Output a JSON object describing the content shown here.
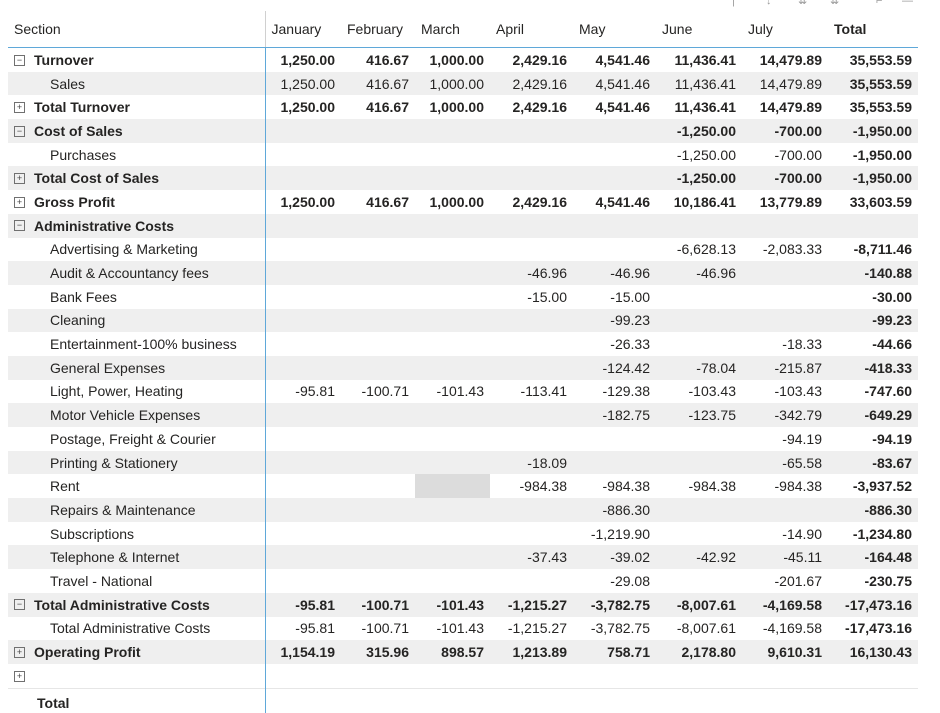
{
  "columns": [
    "Section",
    "January",
    "February",
    "March",
    "April",
    "May",
    "June",
    "July",
    "Total"
  ],
  "rows": [
    {
      "label": "Turnover",
      "expander": "⊟",
      "indent": false,
      "bold": true,
      "shade": false,
      "values": [
        "1,250.00",
        "416.67",
        "1,000.00",
        "2,429.16",
        "4,541.46",
        "11,436.41",
        "14,479.89",
        "35,553.59"
      ]
    },
    {
      "label": "Sales",
      "expander": "",
      "indent": true,
      "bold": false,
      "shade": true,
      "values": [
        "1,250.00",
        "416.67",
        "1,000.00",
        "2,429.16",
        "4,541.46",
        "11,436.41",
        "14,479.89",
        "35,553.59"
      ]
    },
    {
      "label": "Total Turnover",
      "expander": "⊞",
      "indent": false,
      "bold": true,
      "shade": false,
      "values": [
        "1,250.00",
        "416.67",
        "1,000.00",
        "2,429.16",
        "4,541.46",
        "11,436.41",
        "14,479.89",
        "35,553.59"
      ]
    },
    {
      "label": "Cost of Sales",
      "expander": "⊟",
      "indent": false,
      "bold": true,
      "shade": true,
      "values": [
        "",
        "",
        "",
        "",
        "",
        "-1,250.00",
        "-700.00",
        "-1,950.00"
      ]
    },
    {
      "label": "Purchases",
      "expander": "",
      "indent": true,
      "bold": false,
      "shade": false,
      "values": [
        "",
        "",
        "",
        "",
        "",
        "-1,250.00",
        "-700.00",
        "-1,950.00"
      ]
    },
    {
      "label": "Total Cost of Sales",
      "expander": "⊞",
      "indent": false,
      "bold": true,
      "shade": true,
      "values": [
        "",
        "",
        "",
        "",
        "",
        "-1,250.00",
        "-700.00",
        "-1,950.00"
      ]
    },
    {
      "label": "Gross Profit",
      "expander": "⊞",
      "indent": false,
      "bold": true,
      "shade": false,
      "values": [
        "1,250.00",
        "416.67",
        "1,000.00",
        "2,429.16",
        "4,541.46",
        "10,186.41",
        "13,779.89",
        "33,603.59"
      ]
    },
    {
      "label": "Administrative Costs",
      "expander": "⊟",
      "indent": false,
      "bold": true,
      "shade": true,
      "values": [
        "",
        "",
        "",
        "",
        "",
        "",
        "",
        ""
      ]
    },
    {
      "label": "Advertising & Marketing",
      "expander": "",
      "indent": true,
      "bold": false,
      "shade": false,
      "values": [
        "",
        "",
        "",
        "",
        "",
        "-6,628.13",
        "-2,083.33",
        "-8,711.46"
      ]
    },
    {
      "label": "Audit & Accountancy fees",
      "expander": "",
      "indent": true,
      "bold": false,
      "shade": true,
      "values": [
        "",
        "",
        "",
        "-46.96",
        "-46.96",
        "-46.96",
        "",
        "-140.88"
      ]
    },
    {
      "label": "Bank Fees",
      "expander": "",
      "indent": true,
      "bold": false,
      "shade": false,
      "values": [
        "",
        "",
        "",
        "-15.00",
        "-15.00",
        "",
        "",
        "-30.00"
      ]
    },
    {
      "label": "Cleaning",
      "expander": "",
      "indent": true,
      "bold": false,
      "shade": true,
      "values": [
        "",
        "",
        "",
        "",
        "-99.23",
        "",
        "",
        "-99.23"
      ]
    },
    {
      "label": "Entertainment-100% business",
      "expander": "",
      "indent": true,
      "bold": false,
      "shade": false,
      "values": [
        "",
        "",
        "",
        "",
        "-26.33",
        "",
        "-18.33",
        "-44.66"
      ]
    },
    {
      "label": "General Expenses",
      "expander": "",
      "indent": true,
      "bold": false,
      "shade": true,
      "values": [
        "",
        "",
        "",
        "",
        "-124.42",
        "-78.04",
        "-215.87",
        "-418.33"
      ]
    },
    {
      "label": "Light, Power, Heating",
      "expander": "",
      "indent": true,
      "bold": false,
      "shade": false,
      "values": [
        "-95.81",
        "-100.71",
        "-101.43",
        "-113.41",
        "-129.38",
        "-103.43",
        "-103.43",
        "-747.60"
      ]
    },
    {
      "label": "Motor Vehicle Expenses",
      "expander": "",
      "indent": true,
      "bold": false,
      "shade": true,
      "values": [
        "",
        "",
        "",
        "",
        "-182.75",
        "-123.75",
        "-342.79",
        "-649.29"
      ]
    },
    {
      "label": "Postage, Freight & Courier",
      "expander": "",
      "indent": true,
      "bold": false,
      "shade": false,
      "values": [
        "",
        "",
        "",
        "",
        "",
        "",
        "-94.19",
        "-94.19"
      ]
    },
    {
      "label": "Printing & Stationery",
      "expander": "",
      "indent": true,
      "bold": false,
      "shade": true,
      "values": [
        "",
        "",
        "",
        "-18.09",
        "",
        "",
        "-65.58",
        "-83.67"
      ]
    },
    {
      "label": "Rent",
      "expander": "",
      "indent": true,
      "bold": false,
      "shade": false,
      "selected_col": 2,
      "values": [
        "",
        "",
        "",
        "-984.38",
        "-984.38",
        "-984.38",
        "-984.38",
        "-3,937.52"
      ]
    },
    {
      "label": "Repairs & Maintenance",
      "expander": "",
      "indent": true,
      "bold": false,
      "shade": true,
      "values": [
        "",
        "",
        "",
        "",
        "-886.30",
        "",
        "",
        "-886.30"
      ]
    },
    {
      "label": "Subscriptions",
      "expander": "",
      "indent": true,
      "bold": false,
      "shade": false,
      "values": [
        "",
        "",
        "",
        "",
        "-1,219.90",
        "",
        "-14.90",
        "-1,234.80"
      ]
    },
    {
      "label": "Telephone & Internet",
      "expander": "",
      "indent": true,
      "bold": false,
      "shade": true,
      "values": [
        "",
        "",
        "",
        "-37.43",
        "-39.02",
        "-42.92",
        "-45.11",
        "-164.48"
      ]
    },
    {
      "label": "Travel - National",
      "expander": "",
      "indent": true,
      "bold": false,
      "shade": false,
      "values": [
        "",
        "",
        "",
        "",
        "-29.08",
        "",
        "-201.67",
        "-230.75"
      ]
    },
    {
      "label": "Total Administrative Costs",
      "expander": "⊟",
      "indent": false,
      "bold": true,
      "shade": true,
      "values": [
        "-95.81",
        "-100.71",
        "-101.43",
        "-1,215.27",
        "-3,782.75",
        "-8,007.61",
        "-4,169.58",
        "-17,473.16"
      ]
    },
    {
      "label": "Total Administrative Costs",
      "expander": "",
      "indent": true,
      "bold": false,
      "shade": false,
      "values": [
        "-95.81",
        "-100.71",
        "-101.43",
        "-1,215.27",
        "-3,782.75",
        "-8,007.61",
        "-4,169.58",
        "-17,473.16"
      ]
    },
    {
      "label": "Operating Profit",
      "expander": "⊞",
      "indent": false,
      "bold": true,
      "shade": true,
      "values": [
        "1,154.19",
        "315.96",
        "898.57",
        "1,213.89",
        "758.71",
        "2,178.80",
        "9,610.31",
        "16,130.43"
      ]
    },
    {
      "label": "",
      "expander": "⊞",
      "indent": false,
      "bold": false,
      "shade": false,
      "blank": true,
      "values": [
        "",
        "",
        "",
        "",
        "",
        "",
        "",
        ""
      ]
    }
  ],
  "grand_total": {
    "label": "Total"
  },
  "icons": {
    "expand": "plus-box-icon",
    "collapse": "minus-box-icon"
  },
  "colors": {
    "accent": "#5fa8d9",
    "shade": "#efefef",
    "selected": "#dcdcdc"
  }
}
